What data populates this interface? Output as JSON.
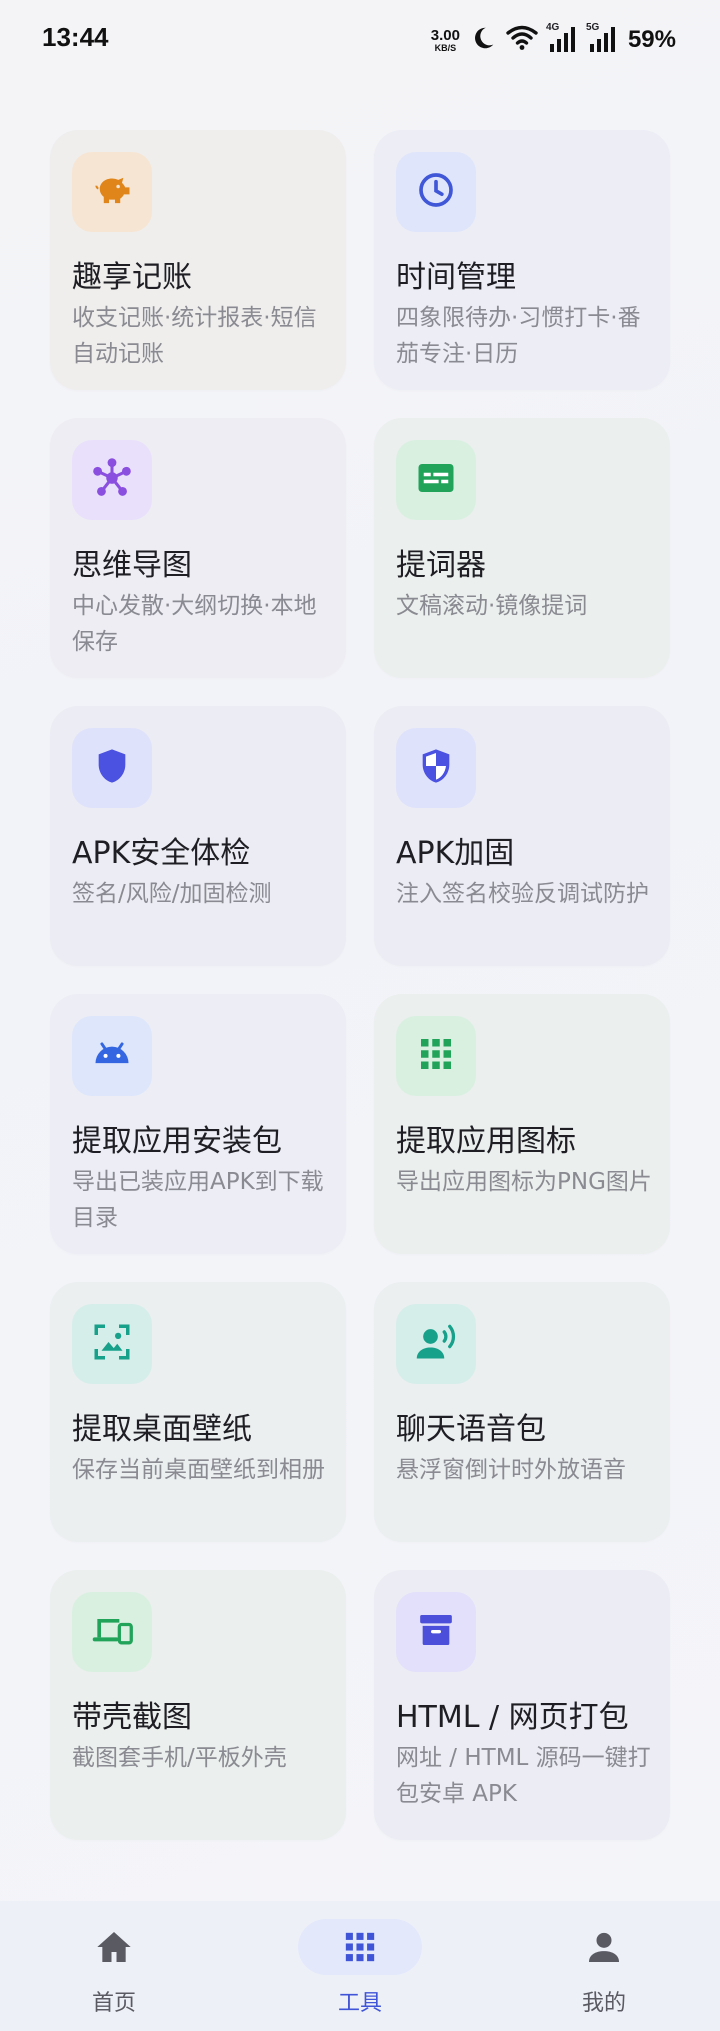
{
  "status_bar": {
    "time": "13:44",
    "net_speed_value": "3.00",
    "net_speed_unit": "KB/S",
    "signal1_label": "4G",
    "signal2_label": "5G",
    "battery": "59%"
  },
  "tools": [
    {
      "title": "趣享记账",
      "desc": "收支记账·统计报表·短信自动记账",
      "icon": "piggy-bank-icon",
      "icon_color": "#e0851a",
      "icon_bg": "#f6e5d3",
      "card_bg": "#efeeed"
    },
    {
      "title": "时间管理",
      "desc": "四象限待办·习惯打卡·番茄专注·日历",
      "icon": "clock-icon",
      "icon_color": "#4057d8",
      "icon_bg": "#dfe5fb",
      "card_bg": "#ecedf5"
    },
    {
      "title": "思维导图",
      "desc": "中心发散·大纲切换·本地保存",
      "icon": "mind-map-icon",
      "icon_color": "#8b4fe0",
      "icon_bg": "#e9e0fb",
      "card_bg": "#eeedf4"
    },
    {
      "title": "提词器",
      "desc": "文稿滚动·镜像提词",
      "icon": "teleprompter-icon",
      "icon_color": "#22a35a",
      "icon_bg": "#d9f0e1",
      "card_bg": "#ebefed"
    },
    {
      "title": "APK安全体检",
      "desc": "签名/风险/加固检测",
      "icon": "shield-icon",
      "icon_color": "#4b51e0",
      "icon_bg": "#dfe2fb",
      "card_bg": "#ecedf4"
    },
    {
      "title": "APK加固",
      "desc": "注入签名校验反调试防护",
      "icon": "security-shield-icon",
      "icon_color": "#4b51e0",
      "icon_bg": "#dfe2fb",
      "card_bg": "#ecedf4"
    },
    {
      "title": "提取应用安装包",
      "desc": "导出已装应用APK到下载目录",
      "icon": "android-icon",
      "icon_color": "#3366e0",
      "icon_bg": "#dde6fb",
      "card_bg": "#ecedf5"
    },
    {
      "title": "提取应用图标",
      "desc": "导出应用图标为PNG图片",
      "icon": "apps-grid-icon",
      "icon_color": "#22a35a",
      "icon_bg": "#d9f0e1",
      "card_bg": "#ebefed"
    },
    {
      "title": "提取桌面壁纸",
      "desc": "保存当前桌面壁纸到相册",
      "icon": "wallpaper-icon",
      "icon_color": "#17a08a",
      "icon_bg": "#d6eee9",
      "card_bg": "#ebeff0"
    },
    {
      "title": "聊天语音包",
      "desc": "悬浮窗倒计时外放语音",
      "icon": "voice-person-icon",
      "icon_color": "#17a08a",
      "icon_bg": "#d6eee9",
      "card_bg": "#ebeff0"
    },
    {
      "title": "带壳截图",
      "desc": "截图套手机/平板外壳",
      "icon": "devices-icon",
      "icon_color": "#22a35a",
      "icon_bg": "#d9f0e1",
      "card_bg": "#ebefed"
    },
    {
      "title": "HTML / 网页打包",
      "desc": "网址 / HTML 源码一键打包安卓 APK",
      "icon": "archive-box-icon",
      "icon_color": "#4b4fd9",
      "icon_bg": "#e2e0fb",
      "card_bg": "#ecedf4"
    }
  ],
  "bottom_nav": {
    "items": [
      {
        "label": "首页",
        "icon": "home-icon"
      },
      {
        "label": "工具",
        "icon": "apps-grid-icon",
        "active": true
      },
      {
        "label": "我的",
        "icon": "person-icon"
      }
    ],
    "active_color": "#3f54d6",
    "inactive_color": "#5a5a63"
  }
}
